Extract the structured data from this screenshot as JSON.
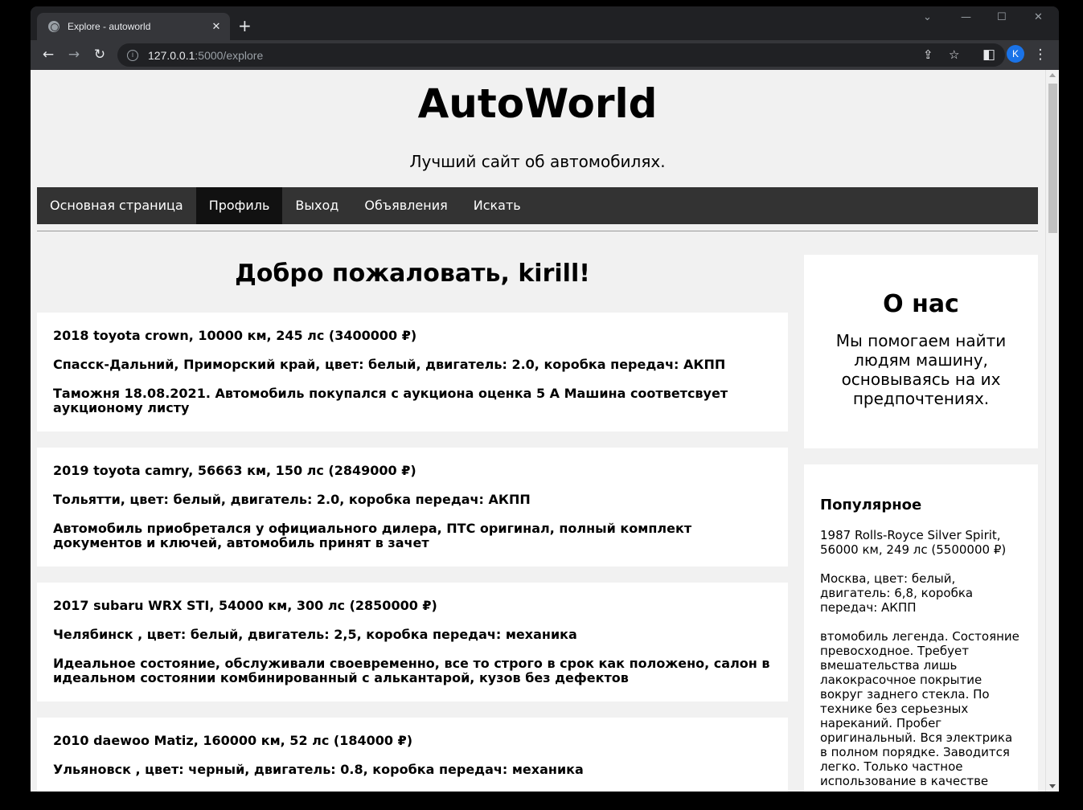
{
  "browser": {
    "tab_title": "Explore - autoworld",
    "url_host": "127.0.0.1",
    "url_path": ":5000/explore",
    "profile_initial": "K"
  },
  "site": {
    "title": "AutoWorld",
    "tagline": "Лучший сайт об автомобилях."
  },
  "nav": {
    "items": [
      {
        "label": "Основная страница"
      },
      {
        "label": "Профиль"
      },
      {
        "label": "Выход"
      },
      {
        "label": "Объявления"
      },
      {
        "label": "Искать"
      }
    ]
  },
  "main": {
    "welcome": "Добро пожаловать, kirill!",
    "listings": [
      {
        "title": "2018 toyota crown, 10000 км, 245 лс (3400000 ₽)",
        "details": "Спасск-Дальний, Приморский край, цвет: белый, двигатель: 2.0, коробка передач: АКПП",
        "description": "Таможня 18.08.2021. Автомобиль покупался с аукциона оценка 5 А Машина соответсвует аукционому листу"
      },
      {
        "title": "2019 toyota camry, 56663 км, 150 лс (2849000 ₽)",
        "details": "Тольятти, цвет: белый, двигатель: 2.0, коробка передач: АКПП",
        "description": "Автомобиль приобретался у официального дилера, ПТС оригинал, полный комплект документов и ключей, автомобиль принят в зачет"
      },
      {
        "title": "2017 subaru WRX STI, 54000 км, 300 лс (2850000 ₽)",
        "details": "Челябинск , цвет: белый, двигатель: 2,5, коробка передач: механика",
        "description": "Идеальное состояние, обслуживали своевременно, все то строго в срок как положено, салон в идеальном состоянии комбинированный с алькантарой, кузов без дефектов"
      },
      {
        "title": "2010 daewoo Matiz, 160000 км, 52 лс (184000 ₽)",
        "details": "Ульяновск , цвет: черный, двигатель: 0.8, коробка передач: механика",
        "description": ""
      }
    ]
  },
  "sidebar": {
    "about_title": "О нас",
    "about_text": "Мы помогаем найти людям машину, основываясь на их предпочтениях.",
    "popular_title": "Популярное",
    "popular_listing": {
      "title": "1987 Rolls-Royce Silver Spirit, 56000 км, 249 лс (5500000 ₽)",
      "details": "Москва, цвет: белый, двигатель: 6,8, коробка передач: АКПП",
      "description": "втомобиль легенда. Состояние превосходное. Требует вмешательства лишь лакокрасочное покрытие вокруг заднего стекла. По технике без серьезных нареканий. Пробег оригинальный. Вся электрика в полном порядке. Заводится легко. Только частное использование в качестве"
    }
  }
}
